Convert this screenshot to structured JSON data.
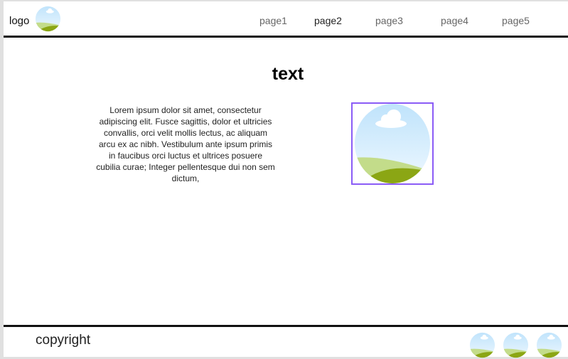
{
  "header": {
    "logo_text": "logo",
    "nav": [
      {
        "label": "page1",
        "active": false
      },
      {
        "label": "page2",
        "active": true
      },
      {
        "label": "page3",
        "active": false
      },
      {
        "label": "page4",
        "active": false
      },
      {
        "label": "page5",
        "active": false
      }
    ]
  },
  "main": {
    "title": "text",
    "paragraph": "Lorem ipsum dolor sit amet, consectetur adipiscing elit. Fusce sagittis, dolor et ultricies convallis, orci velit mollis lectus, ac aliquam arcu ex ac nibh. Vestibulum ante ipsum primis in faucibus orci luctus et ultrices posuere cubilia curae; Integer pellentesque dui non sem dictum,",
    "image_icon": "landscape-image-icon"
  },
  "footer": {
    "copyright": "copyright",
    "icons": [
      "landscape-icon",
      "landscape-icon",
      "landscape-icon"
    ]
  },
  "colors": {
    "selection_border": "#8b5cf6",
    "sky": "#d6efff",
    "grass_light": "#c3dc8a",
    "grass_dark": "#8ba614"
  }
}
